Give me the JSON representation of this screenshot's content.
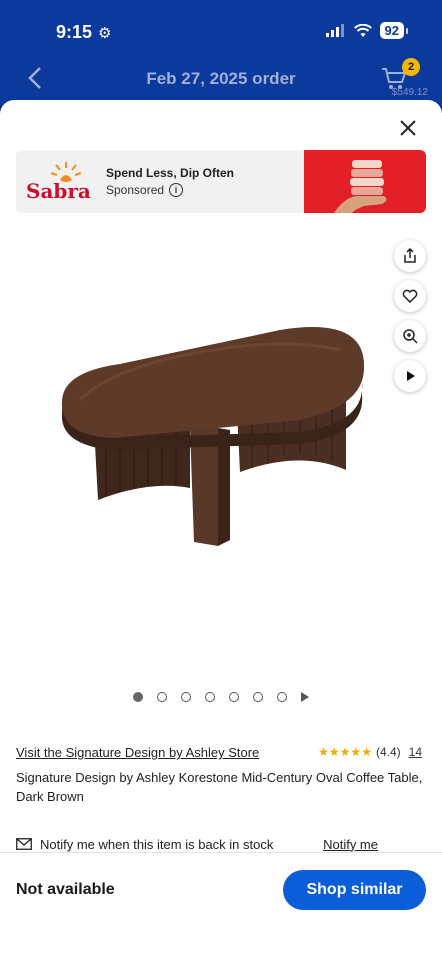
{
  "status": {
    "time": "9:15",
    "battery": "92"
  },
  "nav": {
    "title": "Feb 27, 2025 order",
    "cart_count": "2",
    "cart_total": "$549.12"
  },
  "ad": {
    "brand": "Sabra",
    "headline": "Spend Less, Dip Often",
    "sponsored": "Sponsored",
    "info": "i"
  },
  "carousel": {
    "total_images": 7,
    "active_index": 1
  },
  "product": {
    "store_link": "Visit the Signature Design by Ashley Store",
    "rating": 4.4,
    "rating_text": "(4.4)",
    "stars": "★★★★★",
    "review_count": "14",
    "title": "Signature Design by Ashley Korestone Mid-Century Oval Coffee Table, Dark Brown"
  },
  "notify": {
    "text": "Notify me when this item is back in stock",
    "link": "Notify me"
  },
  "footer": {
    "status": "Not available",
    "button": "Shop similar"
  },
  "colors": {
    "walmart_blue": "#0b3a9c",
    "button_blue": "#0b5ed7",
    "star": "#f2a900",
    "badge": "#f2b705"
  },
  "icons": [
    "settings-icon",
    "signal-icon",
    "wifi-icon",
    "back-arrow-icon",
    "cart-icon",
    "close-icon",
    "info-icon",
    "share-icon",
    "heart-icon",
    "zoom-icon",
    "play-icon",
    "mail-icon"
  ]
}
